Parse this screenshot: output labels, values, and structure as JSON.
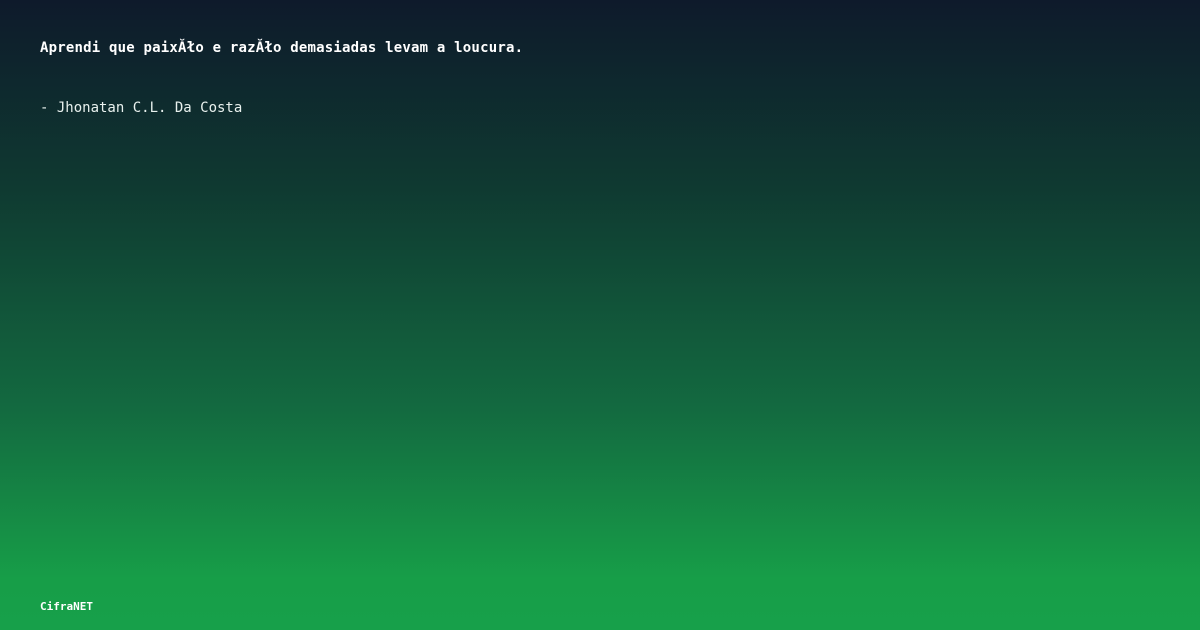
{
  "quote": {
    "text": "Aprendi que paixĂło e razĂło demasiadas levam a loucura.",
    "author": "- Jhonatan C.L. Da Costa"
  },
  "brand": {
    "name": "CifraNET"
  },
  "colors": {
    "gradient_top": "#0e1a2b",
    "gradient_bottom": "#17a04a",
    "text": "#ffffff"
  }
}
